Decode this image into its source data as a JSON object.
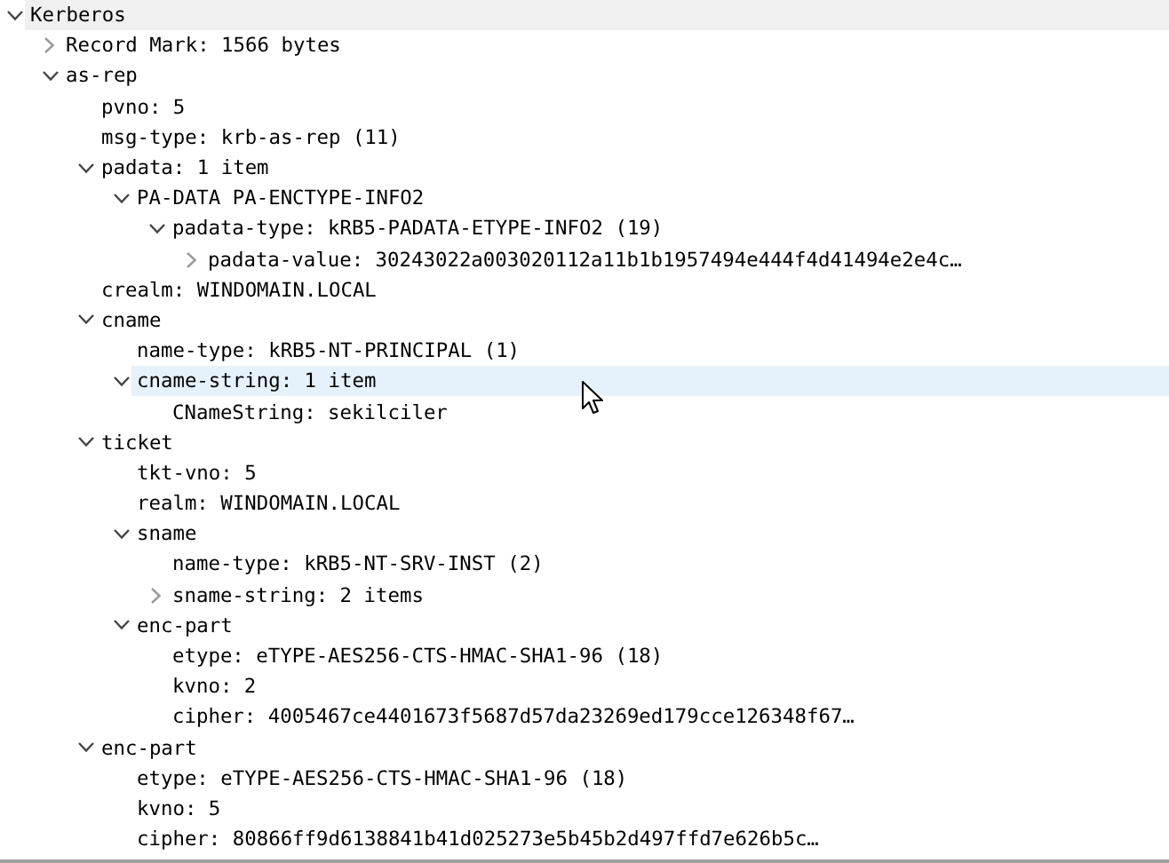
{
  "tree": [
    {
      "label": "Kerberos",
      "expanded": true,
      "selected": true,
      "hovered": false,
      "children": [
        {
          "label": "Record Mark: 1566 bytes",
          "expanded": false,
          "selected": false,
          "hovered": false
        },
        {
          "label": "as-rep",
          "expanded": true,
          "selected": false,
          "hovered": false,
          "children": [
            {
              "label": "pvno: 5",
              "selected": false,
              "hovered": false
            },
            {
              "label": "msg-type: krb-as-rep (11)",
              "selected": false,
              "hovered": false
            },
            {
              "label": "padata: 1 item",
              "expanded": true,
              "selected": false,
              "hovered": false,
              "children": [
                {
                  "label": "PA-DATA PA-ENCTYPE-INFO2",
                  "expanded": true,
                  "selected": false,
                  "hovered": false,
                  "children": [
                    {
                      "label": "padata-type: kRB5-PADATA-ETYPE-INFO2 (19)",
                      "expanded": true,
                      "selected": false,
                      "hovered": false,
                      "children": [
                        {
                          "label": "padata-value: 30243022a003020112a11b1b1957494e444f4d41494e2e4c…",
                          "expanded": false,
                          "selected": false,
                          "hovered": false
                        }
                      ]
                    }
                  ]
                }
              ]
            },
            {
              "label": "crealm: WINDOMAIN.LOCAL",
              "selected": false,
              "hovered": false
            },
            {
              "label": "cname",
              "expanded": true,
              "selected": false,
              "hovered": false,
              "children": [
                {
                  "label": "name-type: kRB5-NT-PRINCIPAL (1)",
                  "selected": false,
                  "hovered": false
                },
                {
                  "label": "cname-string: 1 item",
                  "expanded": true,
                  "selected": false,
                  "hovered": true,
                  "children": [
                    {
                      "label": "CNameString: sekilciler",
                      "selected": false,
                      "hovered": false
                    }
                  ]
                }
              ]
            },
            {
              "label": "ticket",
              "expanded": true,
              "selected": false,
              "hovered": false,
              "children": [
                {
                  "label": "tkt-vno: 5",
                  "selected": false,
                  "hovered": false
                },
                {
                  "label": "realm: WINDOMAIN.LOCAL",
                  "selected": false,
                  "hovered": false
                },
                {
                  "label": "sname",
                  "expanded": true,
                  "selected": false,
                  "hovered": false,
                  "children": [
                    {
                      "label": "name-type: kRB5-NT-SRV-INST (2)",
                      "selected": false,
                      "hovered": false
                    },
                    {
                      "label": "sname-string: 2 items",
                      "expanded": false,
                      "selected": false,
                      "hovered": false
                    }
                  ]
                },
                {
                  "label": "enc-part",
                  "expanded": true,
                  "selected": false,
                  "hovered": false,
                  "children": [
                    {
                      "label": "etype: eTYPE-AES256-CTS-HMAC-SHA1-96 (18)",
                      "selected": false,
                      "hovered": false
                    },
                    {
                      "label": "kvno: 2",
                      "selected": false,
                      "hovered": false
                    },
                    {
                      "label": "cipher: 4005467ce4401673f5687d57da23269ed179cce126348f67…",
                      "selected": false,
                      "hovered": false
                    }
                  ]
                }
              ]
            },
            {
              "label": "enc-part",
              "expanded": true,
              "selected": false,
              "hovered": false,
              "children": [
                {
                  "label": "etype: eTYPE-AES256-CTS-HMAC-SHA1-96 (18)",
                  "selected": false,
                  "hovered": false
                },
                {
                  "label": "kvno: 5",
                  "selected": false,
                  "hovered": false
                },
                {
                  "label": "cipher: 80866ff9d6138841b41d025273e5b45b2d497ffd7e626b5c…",
                  "selected": false,
                  "hovered": false
                }
              ]
            }
          ]
        }
      ]
    }
  ]
}
